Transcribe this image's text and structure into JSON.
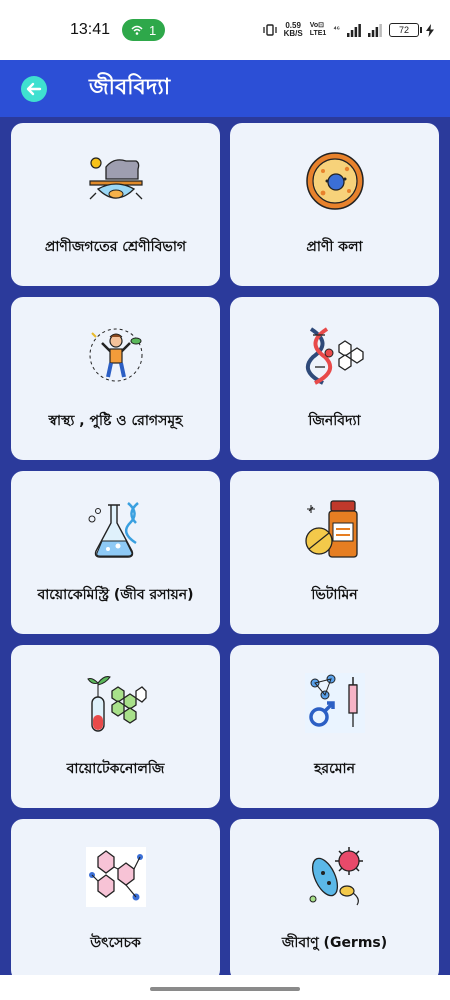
{
  "status": {
    "time": "13:41",
    "hotspot_count": "1",
    "speed_value": "0.59",
    "speed_unit": "KB/S",
    "volte_top": "Vo⊡",
    "volte_bottom": "LTE1",
    "network": "⁴⁶",
    "battery": "72"
  },
  "app_bar": {
    "title": "জীববিদ্যা"
  },
  "categories": [
    {
      "label": "প্রাণীজগতের   শ্রেণীবিভাগ",
      "icon": "animal-classification-icon"
    },
    {
      "label": "প্রাণী কলা",
      "icon": "animal-cell-icon"
    },
    {
      "label": "স্বাস্থ্য , পুষ্টি ও রোগসমূহ",
      "icon": "healthy-person-icon"
    },
    {
      "label": "জিনবিদ্যা",
      "icon": "dna-icon"
    },
    {
      "label": "বায়োকেমিস্ট্রি (জীব রসায়ন)",
      "icon": "flask-dna-icon"
    },
    {
      "label": "ভিটামিন",
      "icon": "vitamin-bottle-icon"
    },
    {
      "label": "বায়োটেকনোলজি",
      "icon": "plant-test-tube-icon"
    },
    {
      "label": "হরমোন",
      "icon": "hormone-syringe-icon"
    },
    {
      "label": "উৎসেচক",
      "icon": "enzyme-molecule-icon"
    },
    {
      "label": "জীবাণু (Germs)",
      "icon": "germs-icon"
    }
  ]
}
